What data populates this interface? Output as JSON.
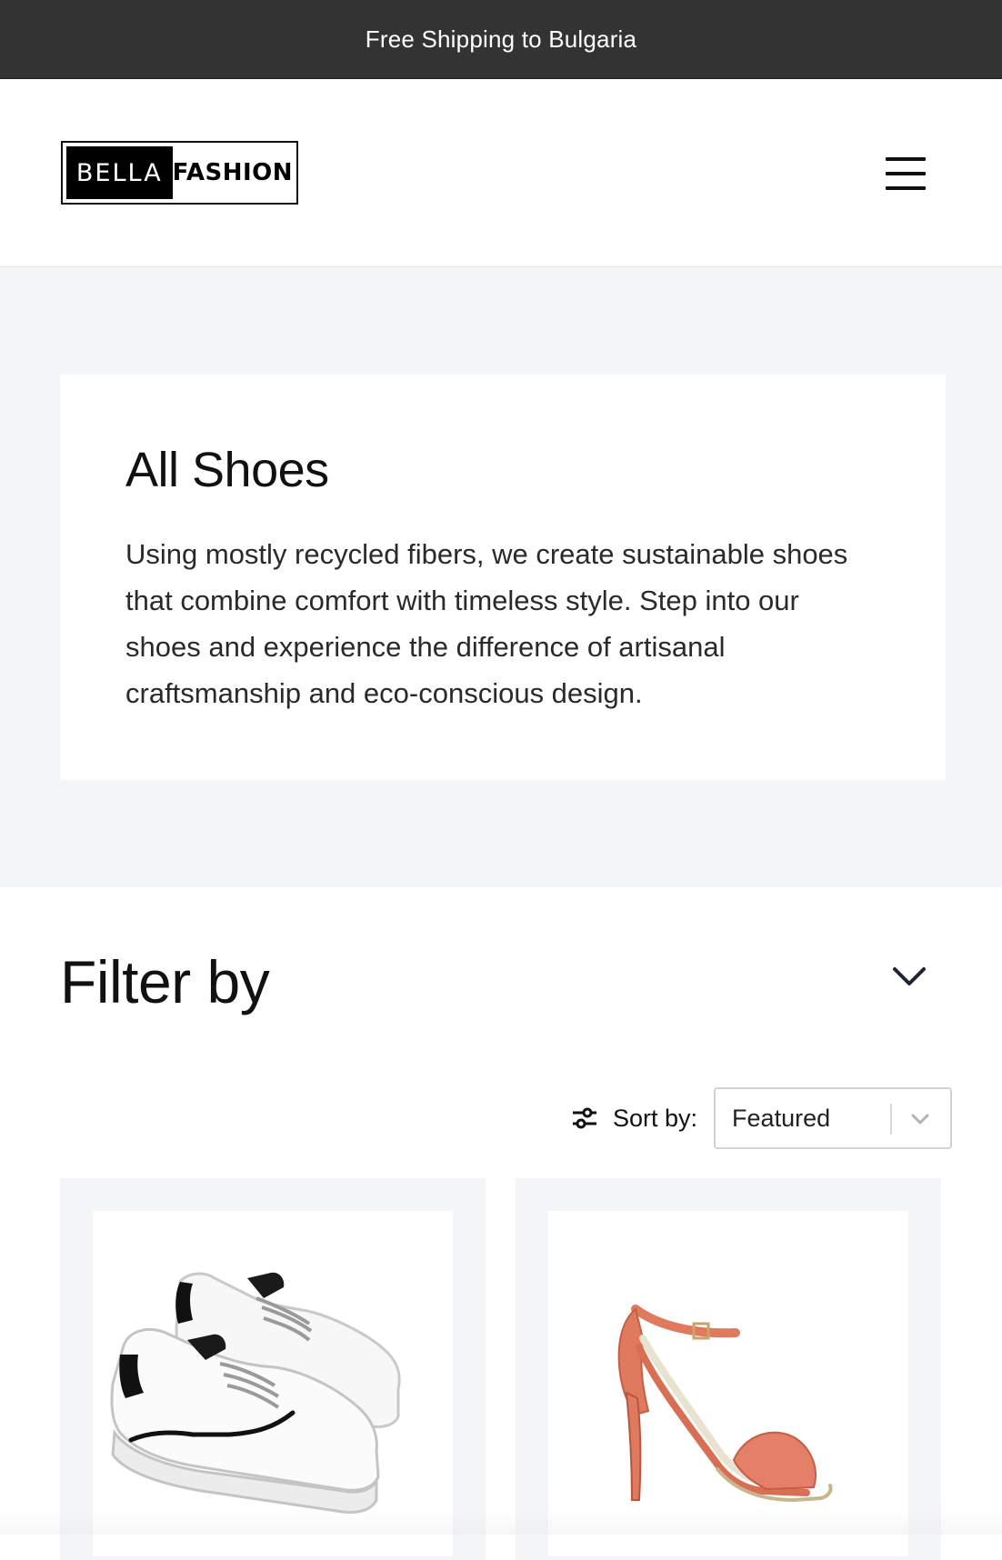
{
  "announcement": {
    "text": "Free Shipping to Bulgaria"
  },
  "header": {
    "logo_left": "BELLA",
    "logo_right": "FASHION",
    "menu_icon": "hamburger-menu-icon"
  },
  "hero": {
    "title": "All Shoes",
    "description": "Using mostly recycled fibers, we create sustainable shoes that combine comfort with timeless style. Step into our shoes and experience the difference of artisanal craftsmanship and eco-conscious design."
  },
  "filter": {
    "title": "Filter by",
    "toggle_icon": "chevron-down-icon"
  },
  "sort": {
    "label": "Sort by:",
    "selected": "Featured",
    "icon": "sliders-icon"
  },
  "products": [
    {
      "image": "white-sneakers",
      "accent": "#111111"
    },
    {
      "image": "coral-high-heel-sandal",
      "accent": "#e07a5f"
    }
  ],
  "colors": {
    "announcement_bg": "#333333",
    "hero_bg": "#f4f5f7",
    "text": "#111111"
  }
}
